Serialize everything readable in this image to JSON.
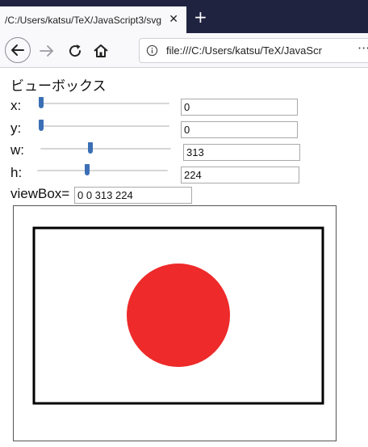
{
  "browser": {
    "tab_title": "/C:/Users/katsu/TeX/JavaScript3/svg",
    "tab_close": "✕",
    "new_tab": "+",
    "url": "file:///C:/Users/katsu/TeX/JavaScr",
    "overflow": "···"
  },
  "page": {
    "heading": "ビューボックス",
    "controls": [
      {
        "label": "x:",
        "value": "0",
        "slider_fraction": 0.0
      },
      {
        "label": "y:",
        "value": "0",
        "slider_fraction": 0.0
      },
      {
        "label": "w:",
        "value": "313",
        "slider_fraction": 0.38
      },
      {
        "label": "h:",
        "value": "224",
        "slider_fraction": 0.38
      }
    ],
    "viewbox_label": "viewBox=",
    "viewbox_value": "0 0 313 224"
  },
  "drawing": {
    "frame_stroke": "#000000",
    "circle_fill": "#ee2a2a",
    "background": "#ffffff"
  },
  "colors": {
    "tabstrip": "#202340",
    "slider_thumb": "#3b6fb5"
  }
}
